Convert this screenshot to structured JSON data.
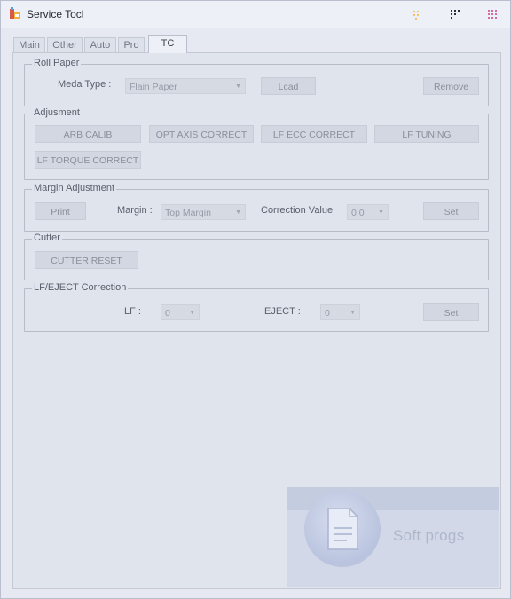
{
  "window": {
    "title": "Service Tocl"
  },
  "tabs": [
    {
      "label": "Main"
    },
    {
      "label": "Other"
    },
    {
      "label": "Auto"
    },
    {
      "label": "Pro"
    },
    {
      "label": "TC"
    }
  ],
  "roll_paper": {
    "group_label": "Roll Paper",
    "media_type_label": "Meda Type :",
    "media_type_value": "Flain Paper",
    "load_label": "Lcad",
    "remove_label": "Remove"
  },
  "adjustment": {
    "group_label": "Adjusment",
    "buttons": [
      {
        "label": "ARB CALIB"
      },
      {
        "label": "OPT AXIS CORRECT"
      },
      {
        "label": "LF ECC CORRECT"
      },
      {
        "label": "LF TUNING"
      },
      {
        "label": "LF TORQUE CORRECT"
      }
    ]
  },
  "margin": {
    "group_label": "Margin Adjustment",
    "print_label": "Print",
    "margin_label": "Margin :",
    "margin_value": "Top Margin",
    "correction_label": "Correction Value",
    "correction_value": "0.0",
    "set_label": "Set"
  },
  "cutter": {
    "group_label": "Cutter",
    "reset_label": "CUTTER RESET"
  },
  "lf_eject": {
    "group_label": "LF/EJECT Correction",
    "lf_label": "LF :",
    "lf_value": "0",
    "eject_label": "EJECT :",
    "eject_value": "0",
    "set_label": "Set"
  },
  "watermark": {
    "text": "Soft progs"
  },
  "colors": {
    "window_bg": "#e6e9f1",
    "page_bg": "#e0e4ed",
    "button_bg": "#d3d7e1",
    "watermark_band": "#c4cce0"
  }
}
